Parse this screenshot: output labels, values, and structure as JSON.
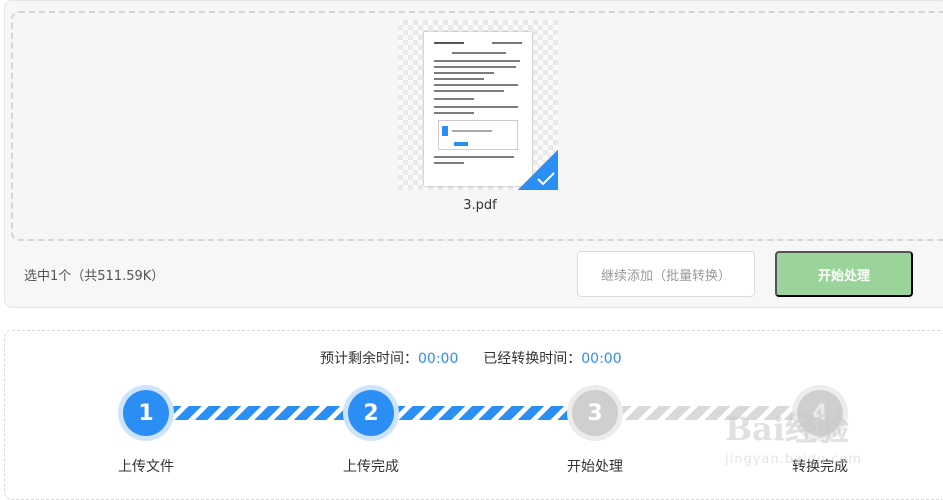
{
  "upload": {
    "file_name": "3.pdf",
    "summary": "选中1个（共511.59K）",
    "add_more_label": "继续添加（批量转换）",
    "start_label": "开始处理"
  },
  "progress": {
    "remaining_label": "预计剩余时间：",
    "remaining_value": "00:00",
    "elapsed_label": "已经转换时间：",
    "elapsed_value": "00:00",
    "steps": [
      {
        "number": "1",
        "label": "上传文件",
        "state": "done"
      },
      {
        "number": "2",
        "label": "上传完成",
        "state": "done"
      },
      {
        "number": "3",
        "label": "开始处理",
        "state": "pending"
      },
      {
        "number": "4",
        "label": "转换完成",
        "state": "pending"
      }
    ]
  },
  "watermark": {
    "brand": "Bai经验",
    "url": "jingyan.baidu.com"
  },
  "colors": {
    "accent": "#2a8ef5",
    "start_button": "#9ad49a",
    "pending": "#cfcfcf"
  }
}
